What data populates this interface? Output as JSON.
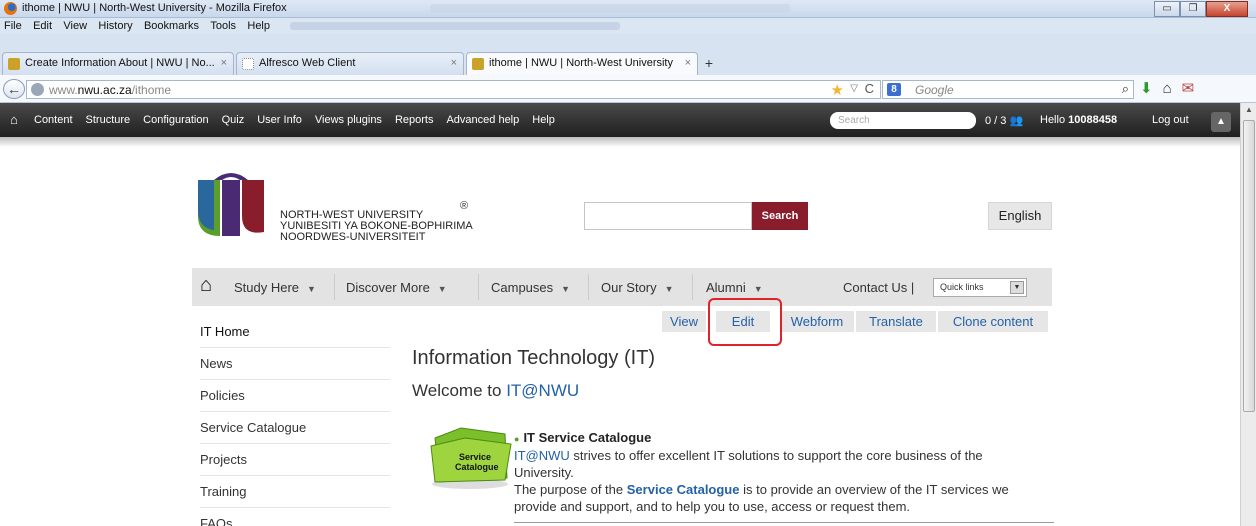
{
  "window": {
    "title": "ithome | NWU | North-West University - Mozilla Firefox",
    "buttons": {
      "minimize": "▭",
      "maximize": "❐",
      "close": "X"
    }
  },
  "menubar": {
    "items": [
      "File",
      "Edit",
      "View",
      "History",
      "Bookmarks",
      "Tools",
      "Help"
    ]
  },
  "tabs": [
    {
      "label": "Create Information About | NWU | No...",
      "close": "×",
      "icon_color": "#c9a227"
    },
    {
      "label": "Alfresco Web Client",
      "close": "×",
      "icon_color": "#cfcfcf"
    },
    {
      "label": "ithome | NWU | North-West University",
      "close": "×",
      "icon_color": "#c9a227"
    }
  ],
  "newtab_label": "+",
  "navbar": {
    "back_glyph": "←",
    "url_prefix": "www.",
    "url_domain": "nwu.ac.za",
    "url_path": "/ithome",
    "search_engine_glyph": "8",
    "search_placeholder": "Google"
  },
  "admin_toolbar": {
    "items": [
      "Content",
      "Structure",
      "Configuration",
      "Quiz",
      "User Info",
      "Views plugins",
      "Reports",
      "Advanced help",
      "Help"
    ],
    "search_placeholder": "Search",
    "counter": "0 / 3",
    "hello_prefix": "Hello",
    "user_id": "10088458",
    "logout": "Log out"
  },
  "site": {
    "university_lines": [
      "NORTH-WEST UNIVERSITY",
      "YUNIBESITI YA BOKONE-BOPHIRIMA",
      "NOORDWES-UNIVERSITEIT"
    ],
    "registered_mark": "®",
    "search_button": "Search",
    "language_button": "English",
    "brand_colors": {
      "maroon": "#8a1d2b",
      "purple": "#4b2a74",
      "green": "#5a9e2c",
      "blue": "#2361a8"
    }
  },
  "mainnav": {
    "items": [
      "Study Here",
      "Discover More",
      "Campuses",
      "Our Story",
      "Alumni"
    ],
    "contact": "Contact Us |",
    "quick_links": "Quick links"
  },
  "local_tabs": [
    "View",
    "Edit",
    "Webform",
    "Translate",
    "Clone content"
  ],
  "sidebar": [
    "IT Home",
    "News",
    "Policies",
    "Service Catalogue",
    "Projects",
    "Training",
    "FAQs"
  ],
  "content": {
    "heading": "Information Technology (IT)",
    "welcome_prefix": "Welcome to",
    "welcome_link": "IT@NWU",
    "catalogue_icon_label_1": "Service",
    "catalogue_icon_label_2": "Catalogue",
    "service_heading": "IT Service Catalogue",
    "para1_link": "IT@NWU",
    "para1_rest": "strives to offer excellent IT solutions to support the core business of the University.",
    "para2_start": "The purpose of the",
    "para2_link": "Service Catalogue",
    "para2_rest": "is to provide an overview of the IT services we provide and support, and to help you to use, access or request them."
  }
}
